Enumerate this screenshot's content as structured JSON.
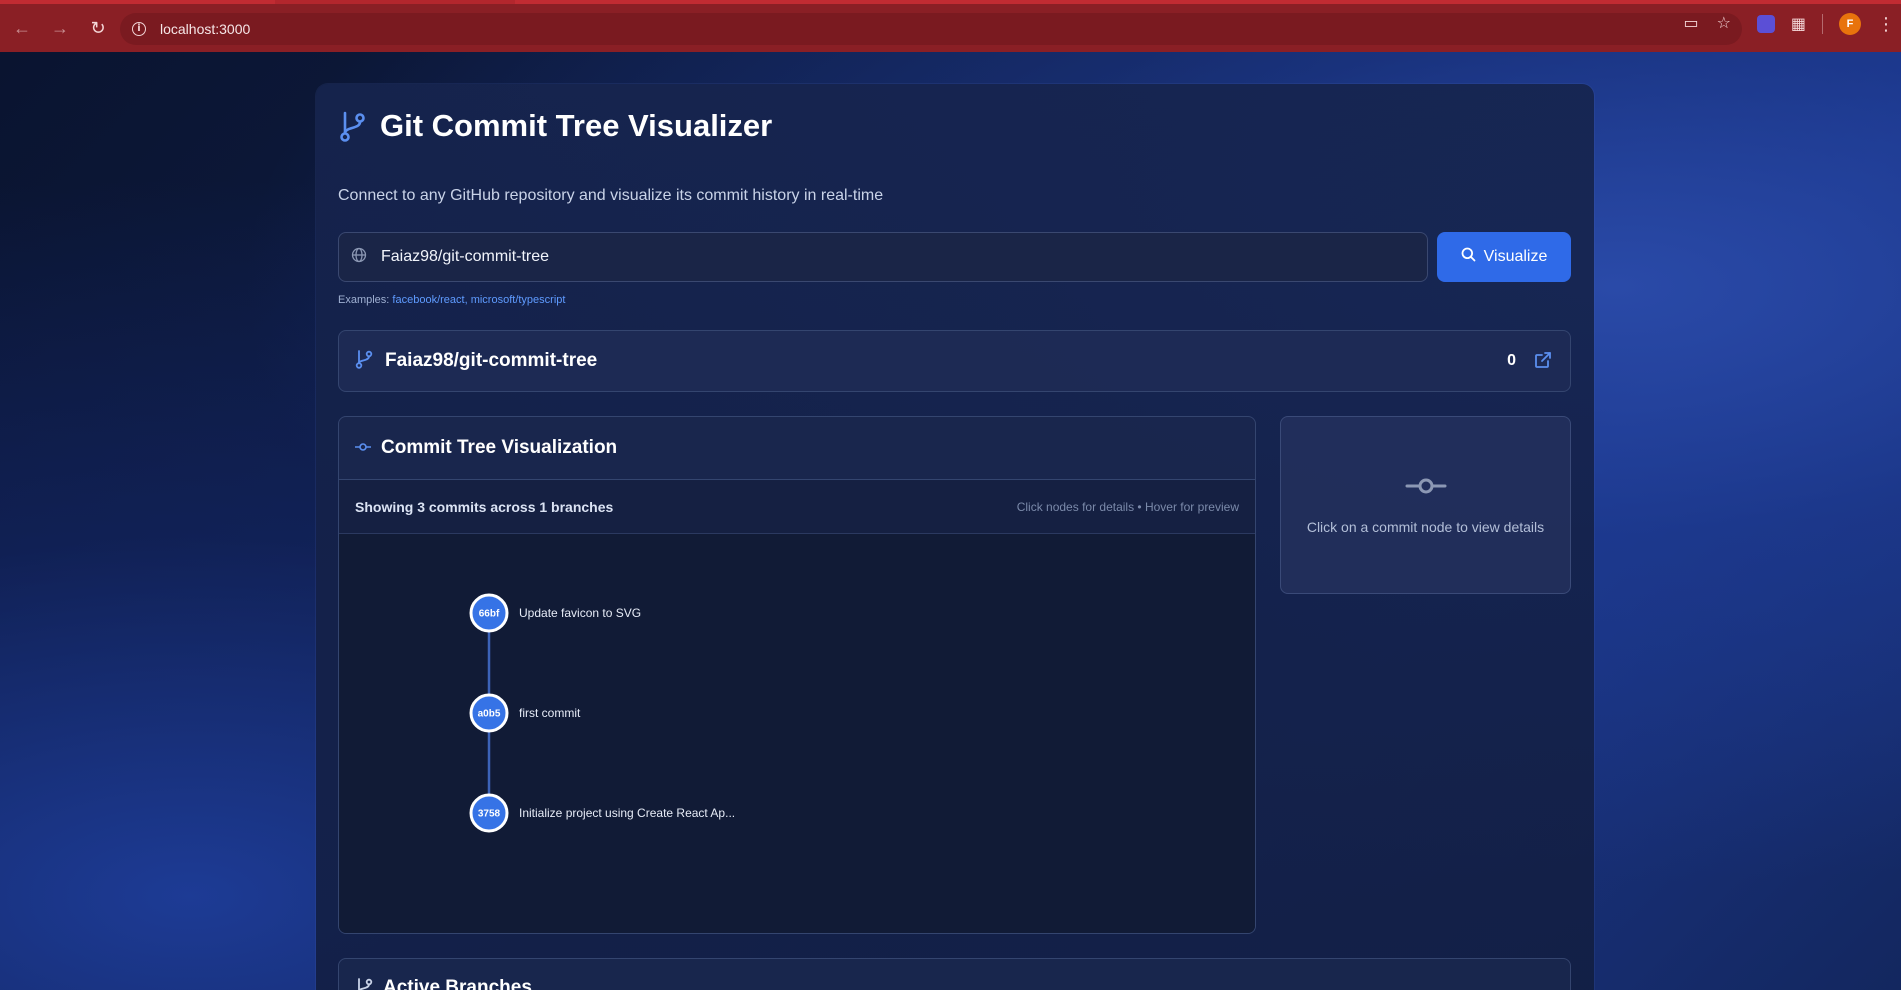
{
  "browser": {
    "url": "localhost:3000",
    "avatar_initial": "F"
  },
  "app": {
    "title": "Git Commit Tree Visualizer",
    "subtitle": "Connect to any GitHub repository and visualize its commit history in real-time",
    "accent_color": "#2f6ae8"
  },
  "search": {
    "value": "Faiaz98/git-commit-tree",
    "button_label": "Visualize"
  },
  "examples": {
    "prefix": "Examples:",
    "items": [
      "facebook/react,",
      "microsoft/typescript"
    ]
  },
  "repo": {
    "name": "Faiaz98/git-commit-tree",
    "count": "0"
  },
  "visualization": {
    "title": "Commit Tree Visualization",
    "summary": "Showing 3 commits across 1 branches",
    "hint": "Click nodes for details • Hover for preview",
    "commits": [
      {
        "short_sha": "66bf",
        "message": "Update favicon to SVG"
      },
      {
        "short_sha": "a0b5",
        "message": "first commit"
      },
      {
        "short_sha": "3758",
        "message": "Initialize project using Create React Ap..."
      }
    ]
  },
  "details": {
    "empty_text": "Click on a commit node to view details"
  },
  "branches": {
    "title": "Active Branches"
  }
}
